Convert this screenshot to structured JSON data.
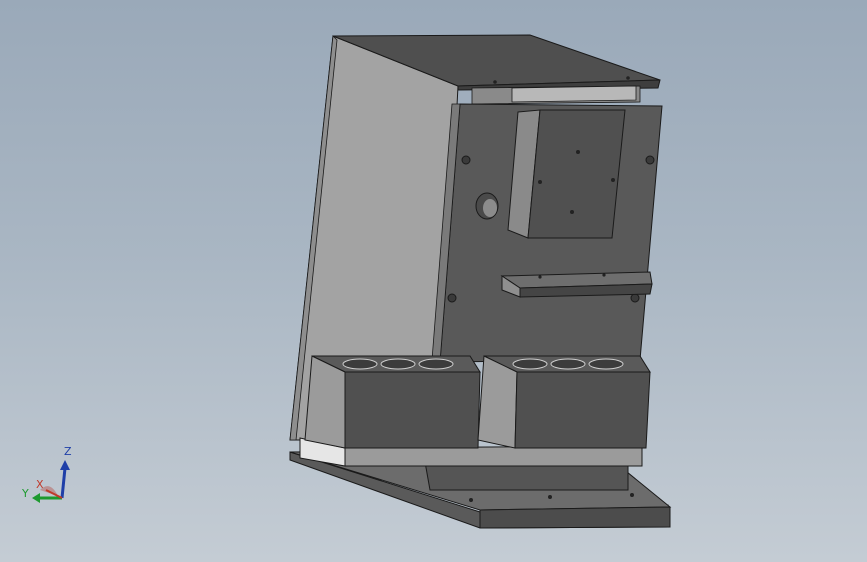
{
  "viewport": {
    "background_top": "#9aa9b9",
    "background_bottom": "#c4ccd4"
  },
  "model": {
    "colors": {
      "dark_face": "#595959",
      "mid_face": "#6e6e6e",
      "light_face": "#9b9b9b",
      "side_panel": "#a3a3a3",
      "top_face": "#4f4f4f",
      "edge": "#1a1a1a",
      "highlight": "#e6e6e6"
    },
    "parts": [
      "side-panel",
      "top-cover",
      "back-plate",
      "motor-block",
      "shelf-bracket",
      "left-holder-block",
      "right-holder-block",
      "base-tray",
      "base-plate"
    ]
  },
  "triad": {
    "z_label": "Z",
    "y_label": "Y",
    "x_label": "X",
    "z_color": "#1f3fa8",
    "y_color": "#1d9a2f",
    "x_color": "#c0392b"
  }
}
